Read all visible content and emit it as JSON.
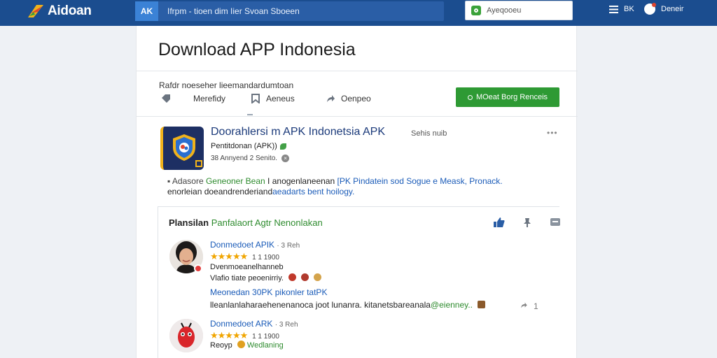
{
  "header": {
    "logo_text": "Aidoan",
    "nav_chip": "AK",
    "nav_links": "Ifrpm - tioen  dim  Iier  Svoan  Sboeen",
    "search_placeholder": "Ayeqooeu",
    "menu_label": "BK",
    "user_label": "Deneir"
  },
  "page": {
    "title": "Download APP Indonesia",
    "subtitle": "Rafdr  noeseher lieemandardumtoan",
    "tabs": [
      {
        "label": "Merefidy",
        "icon": "tag-icon"
      },
      {
        "label": "Aeneus",
        "icon": "bookmark-icon"
      },
      {
        "label": "Oenpeo",
        "icon": "share-icon"
      }
    ],
    "action_button": "MOeat Borg Renceis"
  },
  "app": {
    "name": "Doorahlersi m APK Indonetsia APK",
    "size": "Sehis nuib",
    "more": "•••",
    "subtitle": "Pentitdonan (APK))",
    "meta": "38 Annyend 2 Senito.",
    "info": "×",
    "description": {
      "label": "▪ Adasore",
      "green": "Geneoner Bean",
      "text1": "I anogenlaneenan",
      "blue1": "[PK Pindatein sod Sogue e Meask, Pronack.",
      "text2": "enorleian doeandrenderiand",
      "blue2": "aeadarts bent hoilogy."
    }
  },
  "reviews": {
    "heading": "Plansilan",
    "heading_green": "Panfalaort Agtr Nenonlakan",
    "items": [
      {
        "name": "Donmedoet APIK",
        "time": "· 3 Reh",
        "rating_text": "1 1 1900",
        "stars": "★★★★★",
        "line1": "Dvenmoeanelhanneb",
        "line2": "Vlafio tiate peoenirriy.",
        "title": "Meonedan 30PK pikonler tatPK",
        "text": "lleanlanlaharaehenenanoca joot lunanra. kitanetsbareanala",
        "text_green": "@eienney..",
        "share_count": "1"
      },
      {
        "name": "Donmedoet ARK",
        "time": "· 3 Reh",
        "stars": "★★★★★",
        "rating_text": "1 1 1900",
        "line1": "Reoyp",
        "line1_green": "Wedlaning"
      }
    ]
  },
  "colors": {
    "topbar": "#1b4d8f",
    "accent_green": "#2e9a34",
    "link_blue": "#1a5bb8",
    "star": "#f0a500"
  }
}
